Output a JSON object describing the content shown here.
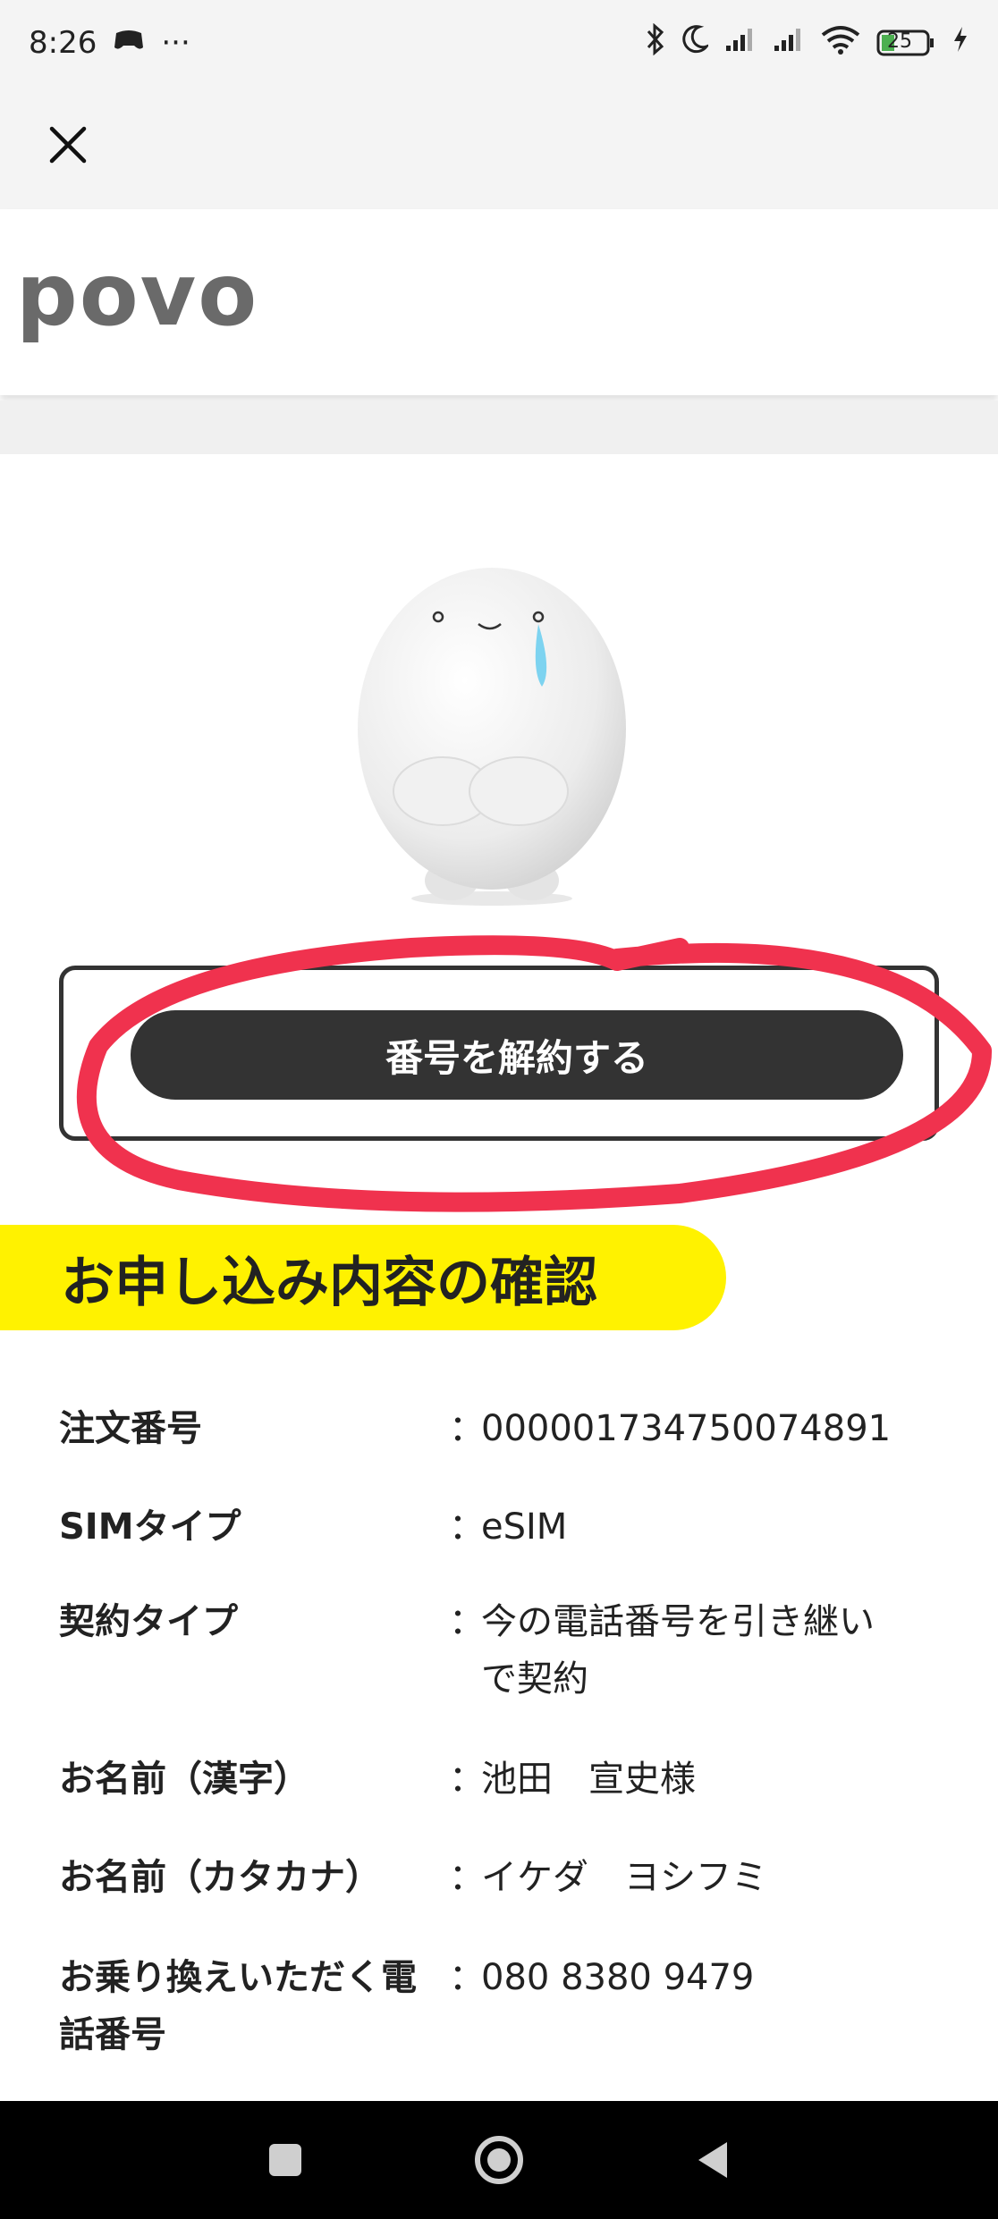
{
  "status_bar": {
    "time": "8:26",
    "more": "···",
    "battery": "25",
    "icons": [
      "gamepad-icon",
      "bluetooth-icon",
      "moon-icon",
      "signal-icon",
      "signal-icon",
      "wifi-icon",
      "battery-icon",
      "charging-icon"
    ]
  },
  "app_bar": {
    "close_icon": "close-icon"
  },
  "header": {
    "logo": "povo"
  },
  "actions": {
    "cancel_number_label": "番号を解約する"
  },
  "section": {
    "title": "お申し込み内容の確認"
  },
  "details": [
    {
      "label": "注文番号",
      "value": "000001734750074891"
    },
    {
      "label": "SIMタイプ",
      "value": "eSIM"
    },
    {
      "label": "契約タイプ",
      "value": "今の電話番号を引き継いで契約"
    },
    {
      "label": "お名前（漢字）",
      "value": "池田　宣史様"
    },
    {
      "label": "お名前（カタカナ）",
      "value": "イケダ　ヨシフミ"
    },
    {
      "label": "お乗り換えいただく電話番号",
      "value": "080 8380 9479"
    }
  ],
  "colon": "：",
  "colors": {
    "accent_yellow": "#fff200",
    "button_dark": "#333333",
    "annotation_red": "#f0324e",
    "logo_gray": "#6a6a6a"
  },
  "nav_bar": [
    "square-icon",
    "home-circle-icon",
    "back-triangle-icon"
  ]
}
